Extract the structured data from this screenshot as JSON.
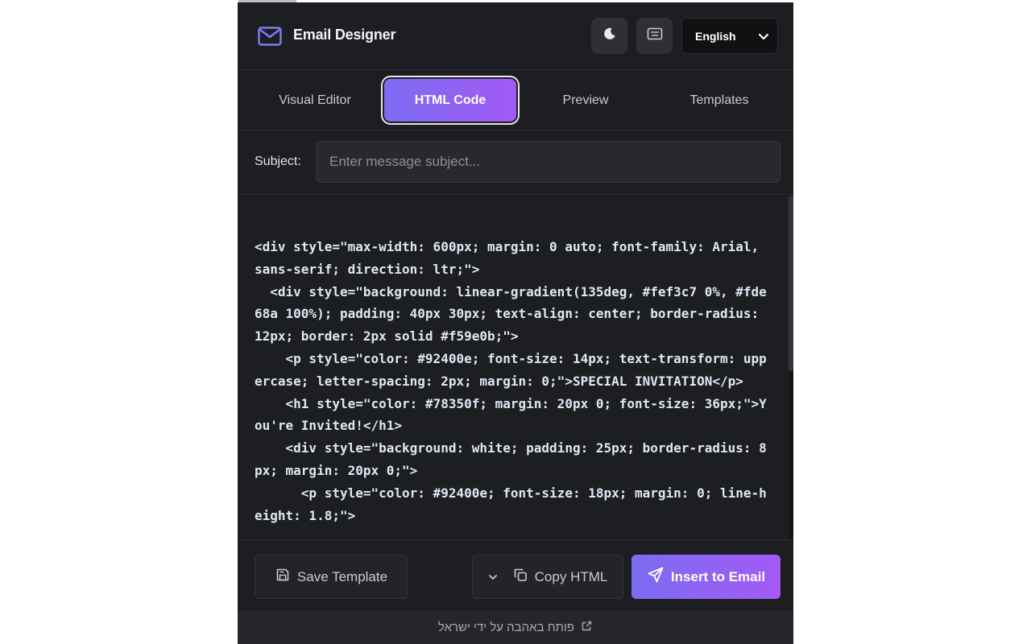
{
  "app": {
    "title": "Email Designer",
    "icons": {
      "brand": "mail-icon",
      "theme": "moon-icon",
      "keyboard": "keyboard-icon"
    },
    "language": {
      "selected": "English"
    }
  },
  "tabs": [
    {
      "label": "Visual Editor",
      "active": false
    },
    {
      "label": "HTML Code",
      "active": true
    },
    {
      "label": "Preview",
      "active": false
    },
    {
      "label": "Templates",
      "active": false
    }
  ],
  "subject": {
    "label": "Subject:",
    "placeholder": "Enter message subject...",
    "value": ""
  },
  "code": {
    "content": "<div style=\"max-width: 600px; margin: 0 auto; font-family: Arial, sans-serif; direction: ltr;\">\n  <div style=\"background: linear-gradient(135deg, #fef3c7 0%, #fde68a 100%); padding: 40px 30px; text-align: center; border-radius: 12px; border: 2px solid #f59e0b;\">\n    <p style=\"color: #92400e; font-size: 14px; text-transform: uppercase; letter-spacing: 2px; margin: 0;\">SPECIAL INVITATION</p>\n    <h1 style=\"color: #78350f; margin: 20px 0; font-size: 36px;\">You're Invited!</h1>\n    <div style=\"background: white; padding: 25px; border-radius: 8px; margin: 20px 0;\">\n      <p style=\"color: #92400e; font-size: 18px; margin: 0; line-height: 1.8;\">"
  },
  "actions": {
    "save_label": "Save Template",
    "copy_label": "Copy HTML",
    "insert_label": "Insert to Email"
  },
  "footer": {
    "text": "פותח באהבה על ידי ישראל"
  },
  "colors": {
    "panel_bg": "#1d1e22",
    "accent_start": "#7c6cf2",
    "accent_end": "#a35af4",
    "brand_icon": "#7f7bf5"
  }
}
